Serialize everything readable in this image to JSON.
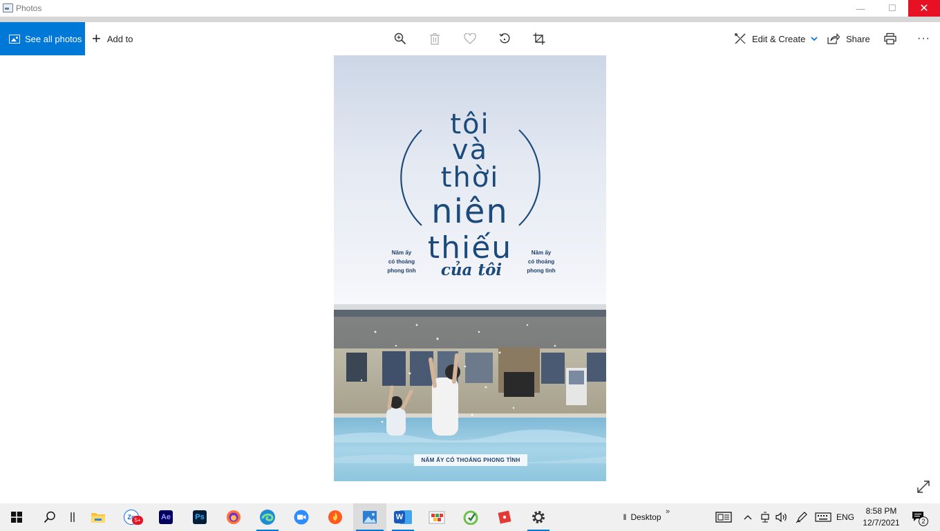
{
  "window": {
    "title": "Photos",
    "controls": {
      "minimize": "—",
      "maximize": "☐",
      "close": "✕"
    }
  },
  "toolbar": {
    "see_all_photos": "See all photos",
    "add_to": "Add to",
    "center_icons": [
      "zoom-in-icon",
      "delete-icon",
      "favorite-icon",
      "rotate-icon",
      "crop-icon"
    ],
    "edit_create": "Edit & Create",
    "share": "Share",
    "more": "···"
  },
  "photo": {
    "title_lines": [
      "tôi",
      "và",
      "thời",
      "niên",
      "thiếu",
      "của tôi"
    ],
    "slogan_left": [
      "Năm ấy",
      "có thoáng",
      "phong tình"
    ],
    "slogan_right": [
      "Năm ấy",
      "có thoáng",
      "phong tình"
    ],
    "bottom_banner": "NĂM ẤY CÓ THOÁNG PHONG TÌNH"
  },
  "taskbar": {
    "apps": [
      {
        "name": "file-explorer-icon"
      },
      {
        "name": "zalo-icon",
        "label": "Zo",
        "badge": "5+"
      },
      {
        "name": "after-effects-icon",
        "label": "Ae"
      },
      {
        "name": "photoshop-icon",
        "label": "Ps"
      },
      {
        "name": "firefox-icon"
      },
      {
        "name": "edge-icon"
      },
      {
        "name": "zoom-icon"
      },
      {
        "name": "brave-icon"
      },
      {
        "name": "photos-icon"
      },
      {
        "name": "word-icon",
        "label": "W"
      },
      {
        "name": "coccoc-icon"
      },
      {
        "name": "green-app-icon"
      },
      {
        "name": "red-app-icon"
      },
      {
        "name": "settings-icon"
      }
    ],
    "desktop_label": "Desktop",
    "desktop_chevron": "»",
    "language": "ENG",
    "time": "8:58 PM",
    "date": "12/7/2021",
    "notification_count": "2"
  },
  "colors": {
    "accent": "#0078d7",
    "close": "#e81123",
    "poster_text": "#1c4a7a"
  }
}
